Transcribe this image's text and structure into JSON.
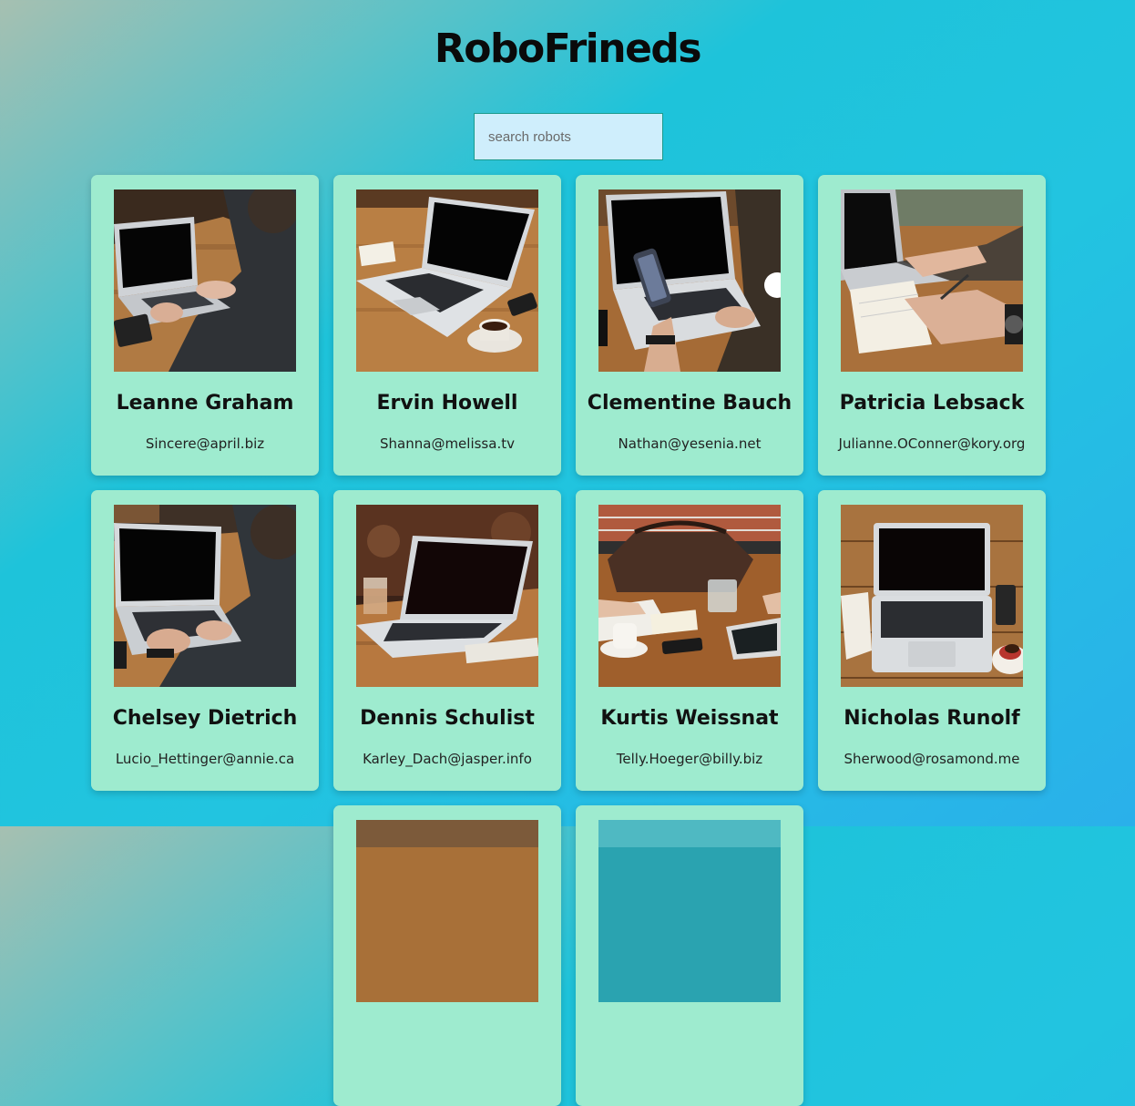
{
  "app": {
    "title": "RoboFrineds"
  },
  "search": {
    "placeholder": "search robots"
  },
  "cards": [
    {
      "name": "Leanne Graham",
      "email": "Sincere@april.biz"
    },
    {
      "name": "Ervin Howell",
      "email": "Shanna@melissa.tv"
    },
    {
      "name": "Clementine Bauch",
      "email": "Nathan@yesenia.net"
    },
    {
      "name": "Patricia Lebsack",
      "email": "Julianne.OConner@kory.org"
    },
    {
      "name": "Chelsey Dietrich",
      "email": "Lucio_Hettinger@annie.ca"
    },
    {
      "name": "Dennis Schulist",
      "email": "Karley_Dach@jasper.info"
    },
    {
      "name": "Kurtis Weissnat",
      "email": "Telly.Hoeger@billy.biz"
    },
    {
      "name": "Nicholas Runolf",
      "email": "Sherwood@rosamond.me"
    },
    {
      "name": "",
      "email": ""
    },
    {
      "name": "",
      "email": ""
    }
  ]
}
